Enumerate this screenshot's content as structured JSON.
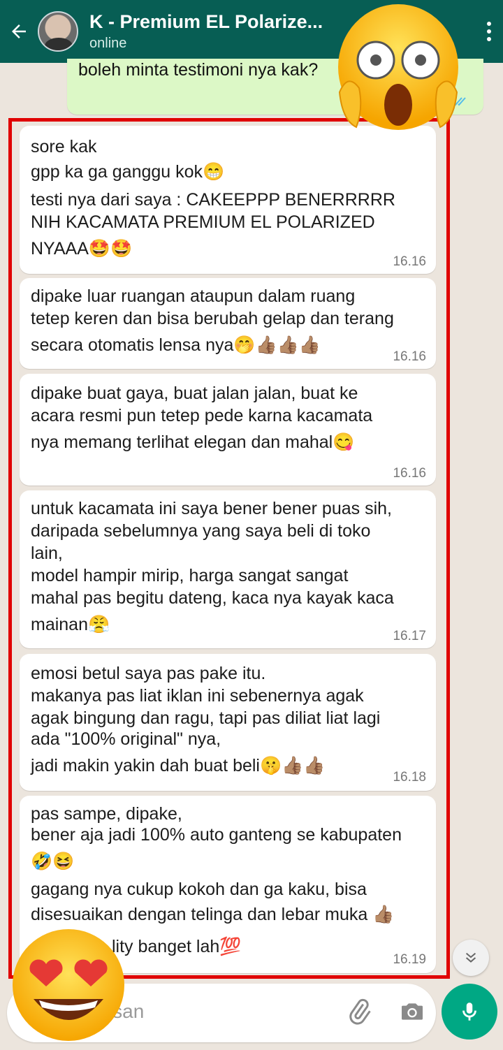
{
  "header": {
    "back_icon": "arrow-left-icon",
    "title": "K - Premium EL Polarize...",
    "status": "online",
    "menu_icon": "more-vert-icon"
  },
  "outgoing": {
    "text": "boleh minta testimoni nya kak?",
    "status_icon": "double-check-icon"
  },
  "messages": [
    {
      "lines": [
        "sore kak",
        "gpp ka ga ganggu kok😁",
        "testi nya dari saya : CAKEEPPP BENERRRRR",
        "NIH KACAMATA PREMIUM EL POLARIZED",
        "NYAAA🤩🤩"
      ],
      "time": "16.16"
    },
    {
      "lines": [
        "dipake luar ruangan ataupun dalam ruang",
        "tetep keren dan bisa berubah gelap dan terang",
        "secara otomatis lensa nya🤭👍🏽👍🏽👍🏽"
      ],
      "time": "16.16"
    },
    {
      "lines": [
        "dipake buat gaya, buat jalan jalan, buat ke",
        "acara resmi pun tetep pede karna kacamata",
        "nya memang terlihat elegan dan mahal😋"
      ],
      "time": "16.16"
    },
    {
      "lines": [
        "untuk kacamata ini saya bener bener puas sih,",
        "daripada sebelumnya yang saya beli di toko",
        "lain,",
        "model hampir mirip, harga sangat sangat",
        "mahal pas begitu dateng, kaca nya kayak kaca",
        "mainan😤"
      ],
      "time": "16.17"
    },
    {
      "lines": [
        "emosi betul saya pas pake itu.",
        "makanya pas liat iklan ini sebenernya agak",
        "agak bingung dan ragu, tapi pas diliat liat lagi",
        "ada \"100% original\" nya,",
        "jadi makin yakin dah buat beli🤫👍🏽👍🏽"
      ],
      "time": "16.18"
    },
    {
      "lines": [
        "pas sampe, dipake,",
        "bener aja jadi 100% auto ganteng se kabupaten",
        "🤣😆",
        "gagang nya cukup kokoh dan ga kaku, bisa",
        "disesuaikan dengan telinga dan lebar muka 👍🏽",
        "lity banget lah💯"
      ],
      "time": "16.19"
    }
  ],
  "composer": {
    "placeholder": "pesan",
    "attach_icon": "paperclip-icon",
    "camera_icon": "camera-icon",
    "mic_icon": "microphone-icon"
  },
  "scroll_icon": "chevron-double-down-icon",
  "stickers": {
    "top": "screaming-face-icon",
    "bottom": "heart-eyes-face-icon"
  },
  "colors": {
    "header": "#075e54",
    "outgoing_bubble": "#dcf8c6",
    "frame": "#e00000",
    "mic_button": "#00a884"
  }
}
